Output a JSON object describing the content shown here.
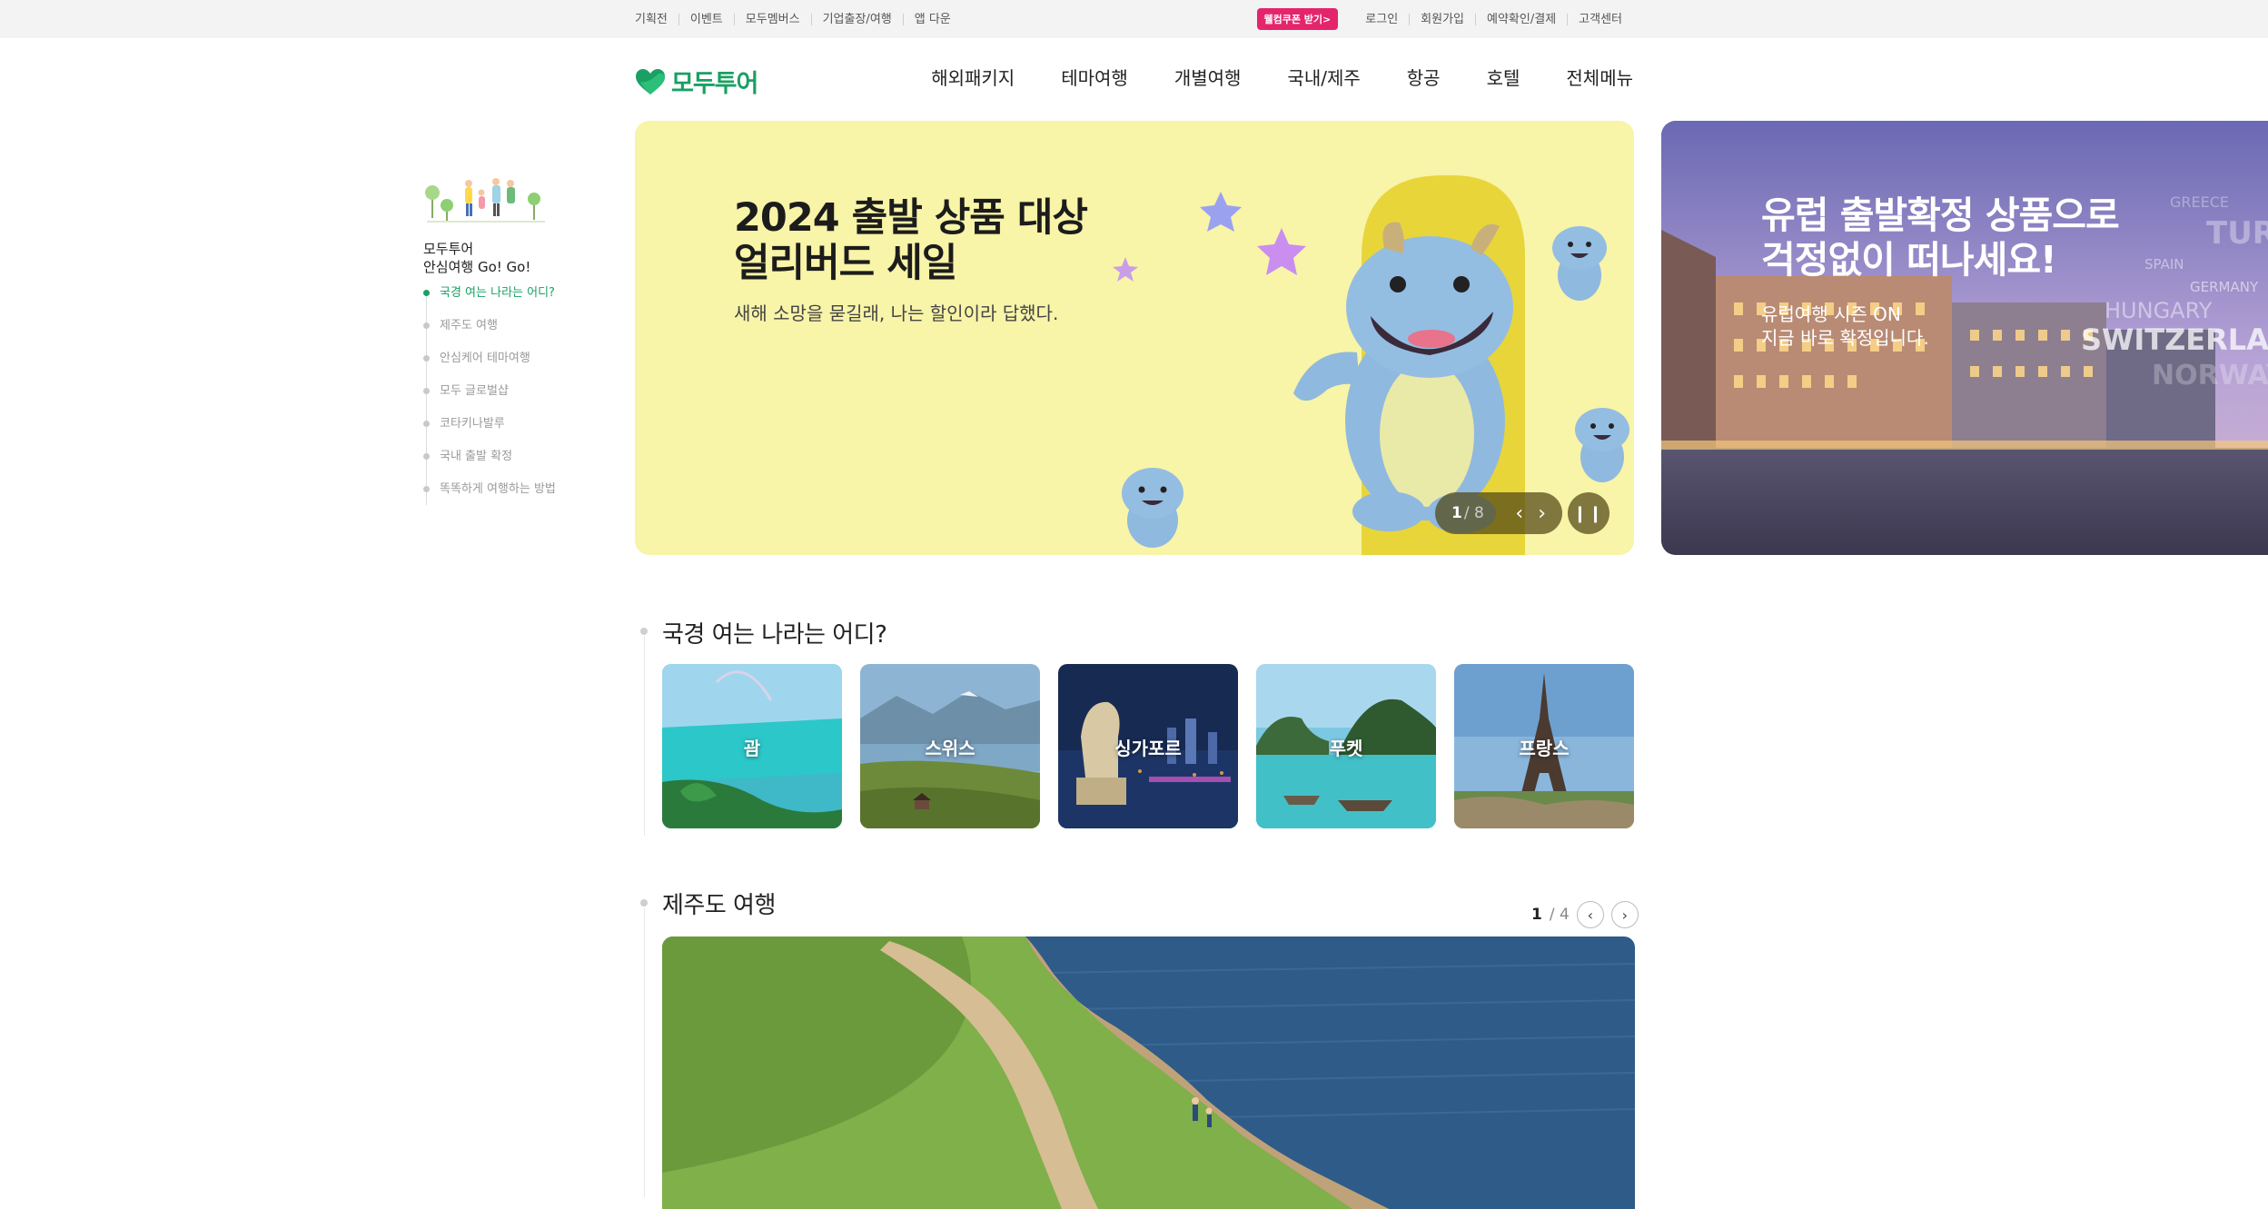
{
  "utility": {
    "left_links": [
      "기획전",
      "이벤트",
      "모두멤버스",
      "기업출장/여행",
      "앱 다운"
    ],
    "coupon_badge": "웰컴쿠폰 받기>",
    "right_links": [
      "로그인",
      "회원가입",
      "예약확인/결제",
      "고객센터"
    ]
  },
  "header": {
    "logo_text": "모두투어",
    "brand_color": "#1aa063",
    "nav": [
      "해외패키지",
      "테마여행",
      "개별여행",
      "국내/제주",
      "항공",
      "호텔",
      "전체메뉴"
    ]
  },
  "side_nav": {
    "title_line1": "모두투어",
    "title_line2": "안심여행 Go! Go!",
    "items": [
      "국경 여는 나라는 어디?",
      "제주도 여행",
      "안심케어 테마여행",
      "모두 글로벌샵",
      "코타키나발루",
      "국내 출발 확정",
      "똑똑하게 여행하는 방법"
    ],
    "active_index": 0
  },
  "hero": {
    "title_line1": "2024 출발 상품 대상",
    "title_line2": "얼리버드 세일",
    "subtitle": "새해 소망을 묻길래, 나는 할인이라 답했다.",
    "current_slide": "1",
    "total_slides": "/ 8",
    "prev_icon": "‹",
    "next_icon": "›",
    "pause_icon": "❙❙"
  },
  "hero_side": {
    "title_line1": "유럽 출발확정 상품으로",
    "title_line2": "걱정없이 떠나세요!",
    "sub_line1": "유럽여행 시즌 ON",
    "sub_line2": "지금 바로 확정입니다.",
    "watermark_words": [
      "GREECE",
      "TURKEY",
      "SPAIN",
      "GERMANY",
      "HUNGARY",
      "SWITZERLAND",
      "NORWAY"
    ]
  },
  "section_border": {
    "title": "국경 여는 나라는 어디?",
    "cards": [
      "괌",
      "스위스",
      "싱가포르",
      "푸켓",
      "프랑스"
    ]
  },
  "section_jeju": {
    "title": "제주도 여행",
    "current": "1",
    "total": "/ 4",
    "prev_icon": "‹",
    "next_icon": "›"
  }
}
